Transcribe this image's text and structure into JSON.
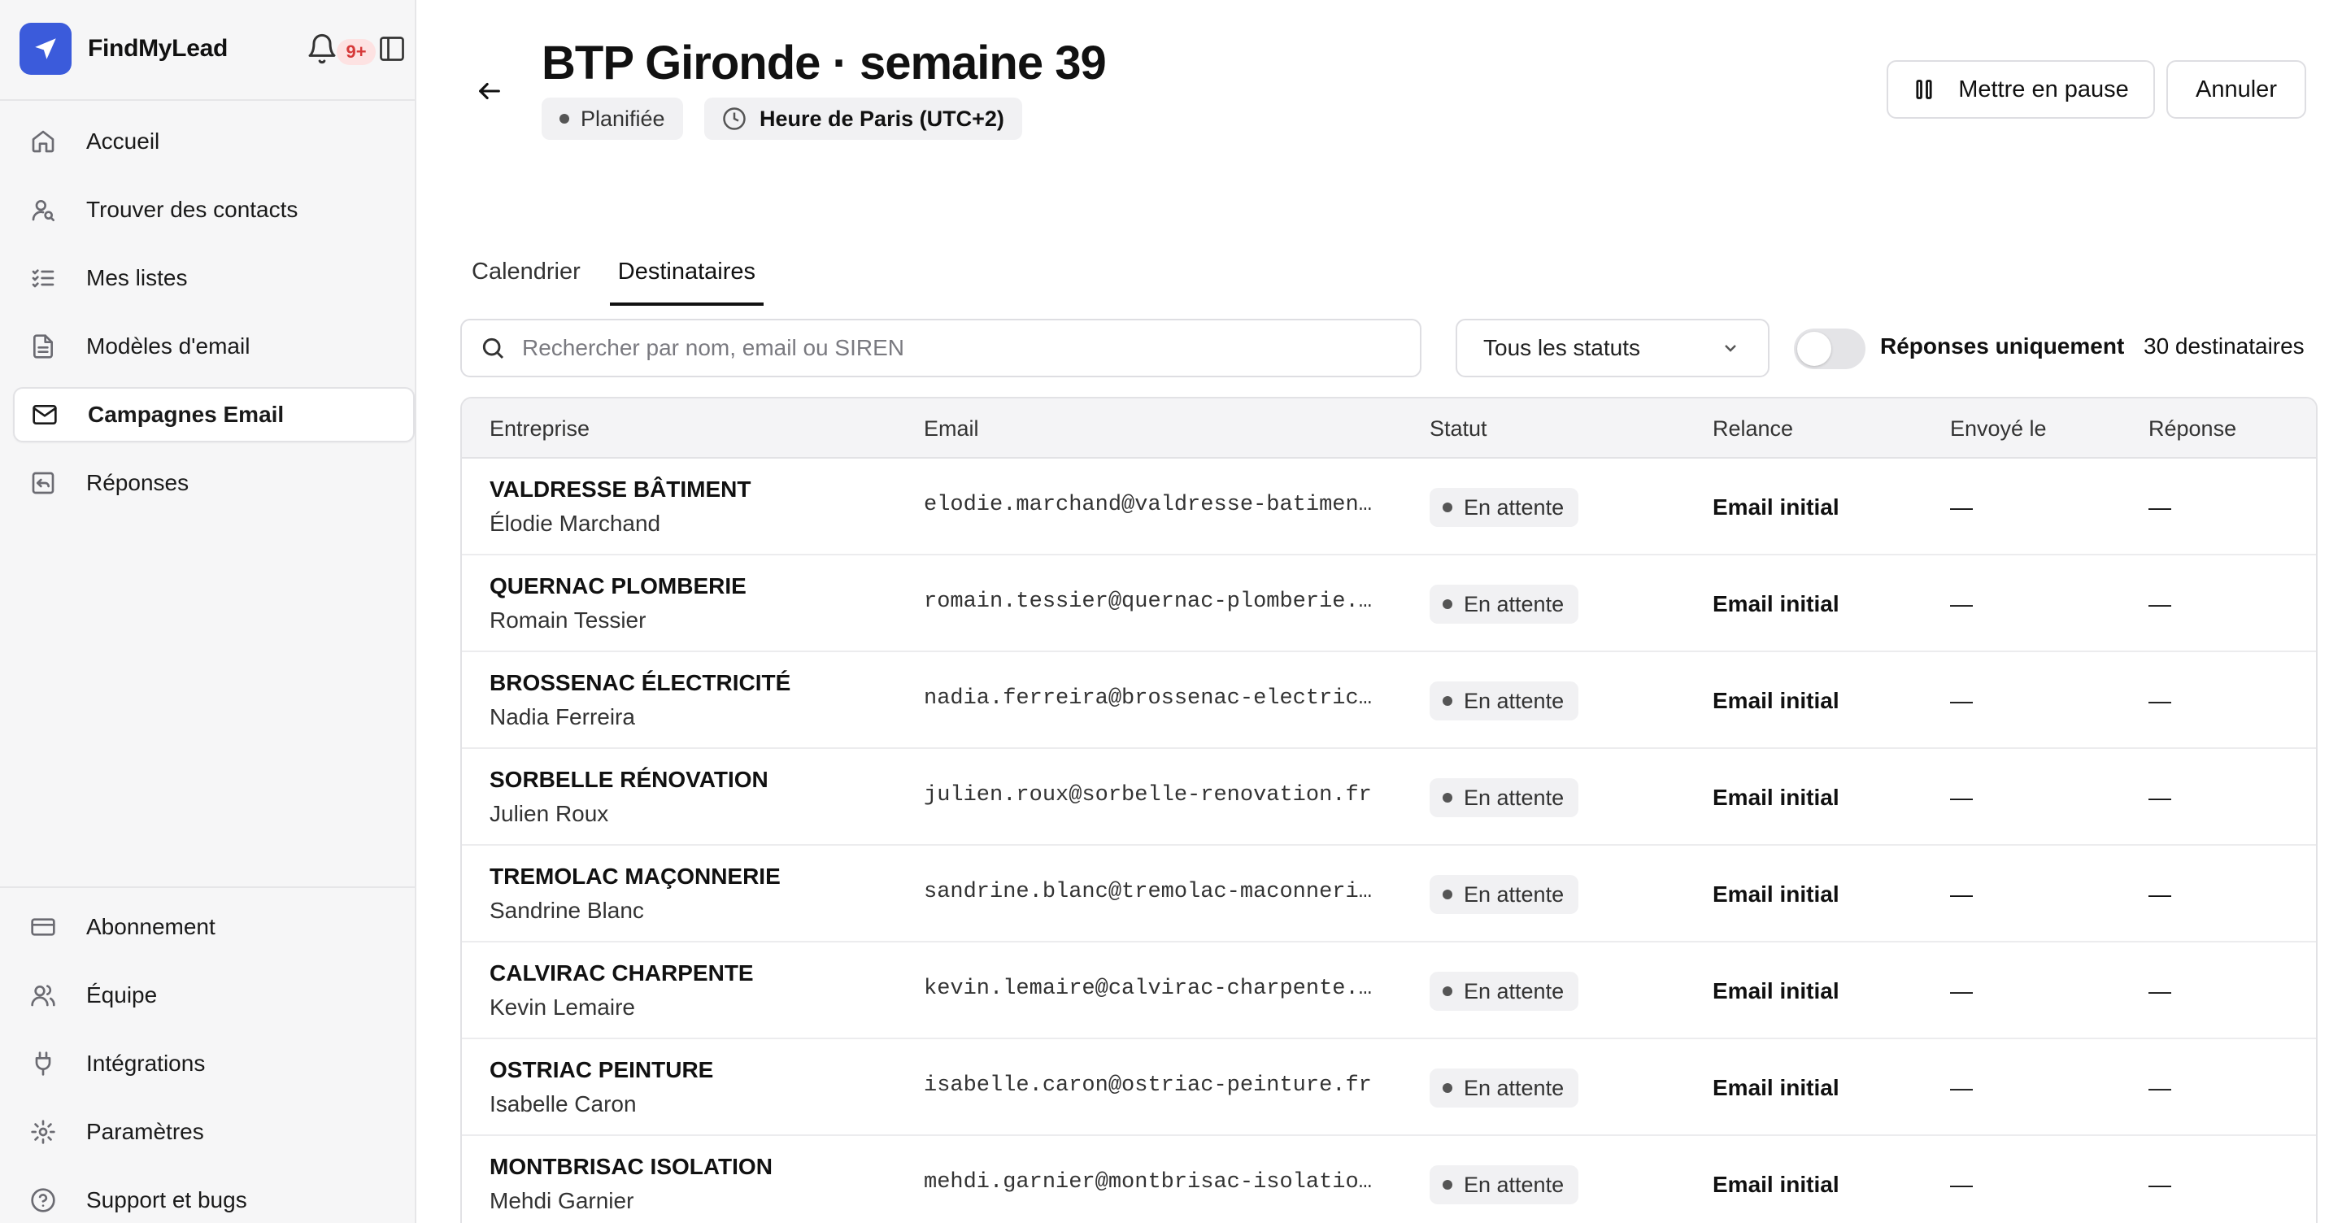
{
  "sidebar": {
    "brand": "FindMyLead",
    "notifications": "9+",
    "nav": [
      {
        "label": "Accueil",
        "icon": "home-icon"
      },
      {
        "label": "Trouver des contacts",
        "icon": "user-search-icon"
      },
      {
        "label": "Mes listes",
        "icon": "list-checks-icon"
      },
      {
        "label": "Modèles d'email",
        "icon": "file-text-icon"
      },
      {
        "label": "Campagnes Email",
        "icon": "mail-icon",
        "active": true
      },
      {
        "label": "Réponses",
        "icon": "reply-icon"
      }
    ],
    "bottom_nav": [
      {
        "label": "Abonnement",
        "icon": "credit-card-icon"
      },
      {
        "label": "Équipe",
        "icon": "users-icon"
      },
      {
        "label": "Intégrations",
        "icon": "plug-icon"
      },
      {
        "label": "Paramètres",
        "icon": "gear-icon"
      },
      {
        "label": "Support et bugs",
        "icon": "help-circle-icon"
      }
    ]
  },
  "header": {
    "title": "BTP Gironde · semaine 39",
    "status": "Planifiée",
    "timezone": "Heure de Paris (UTC+2)",
    "pause_label": "Mettre en pause",
    "cancel_label": "Annuler"
  },
  "tabs": [
    "Calendrier",
    "Destinataires"
  ],
  "active_tab": "Destinataires",
  "filters": {
    "search_placeholder": "Rechercher par nom, email ou SIREN",
    "status_select": "Tous les statuts",
    "replies_only_label": "Réponses uniquement",
    "replies_only": false,
    "count_label": "30 destinataires"
  },
  "table": {
    "columns": [
      "Entreprise",
      "Email",
      "Statut",
      "Relance",
      "Envoyé le",
      "Réponse"
    ],
    "rows": [
      {
        "company": "VALDRESSE BÂTIMENT",
        "contact": "Élodie Marchand",
        "email": "elodie.marchand@valdresse-batiment…",
        "status": "En attente",
        "relance": "Email initial",
        "sent": "—",
        "reply": "—"
      },
      {
        "company": "QUERNAC PLOMBERIE",
        "contact": "Romain Tessier",
        "email": "romain.tessier@quernac-plomberie.fr",
        "status": "En attente",
        "relance": "Email initial",
        "sent": "—",
        "reply": "—"
      },
      {
        "company": "BROSSENAC ÉLECTRICITÉ",
        "contact": "Nadia Ferreira",
        "email": "nadia.ferreira@brossenac-electrici…",
        "status": "En attente",
        "relance": "Email initial",
        "sent": "—",
        "reply": "—"
      },
      {
        "company": "SORBELLE RÉNOVATION",
        "contact": "Julien Roux",
        "email": "julien.roux@sorbelle-renovation.fr",
        "status": "En attente",
        "relance": "Email initial",
        "sent": "—",
        "reply": "—"
      },
      {
        "company": "TREMOLAC MAÇONNERIE",
        "contact": "Sandrine Blanc",
        "email": "sandrine.blanc@tremolac-maconnerie…",
        "status": "En attente",
        "relance": "Email initial",
        "sent": "—",
        "reply": "—"
      },
      {
        "company": "CALVIRAC CHARPENTE",
        "contact": "Kevin Lemaire",
        "email": "kevin.lemaire@calvirac-charpente.fr",
        "status": "En attente",
        "relance": "Email initial",
        "sent": "—",
        "reply": "—"
      },
      {
        "company": "OSTRIAC PEINTURE",
        "contact": "Isabelle Caron",
        "email": "isabelle.caron@ostriac-peinture.fr",
        "status": "En attente",
        "relance": "Email initial",
        "sent": "—",
        "reply": "—"
      },
      {
        "company": "MONTBRISAC ISOLATION",
        "contact": "Mehdi Garnier",
        "email": "mehdi.garnier@montbrisac-isolation…",
        "status": "En attente",
        "relance": "Email initial",
        "sent": "—",
        "reply": "—"
      }
    ]
  },
  "colors": {
    "brand": "#3b5bdb",
    "badge_bg": "#f1f1f3",
    "notification": "#d63a3a"
  }
}
